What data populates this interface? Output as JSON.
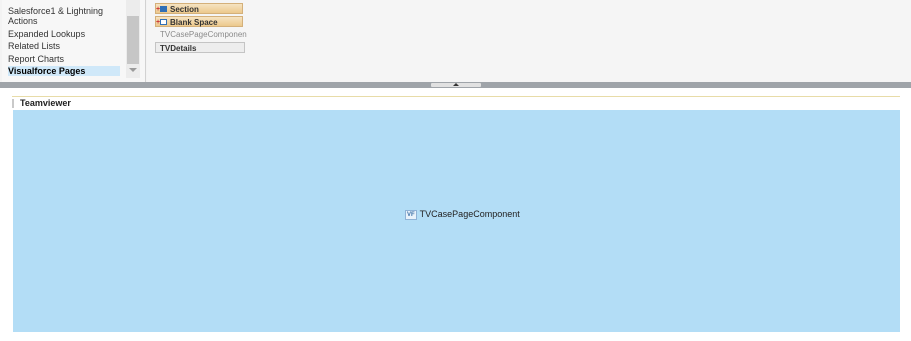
{
  "palette": {
    "categories": [
      "Salesforce1 & Lightning",
      "Actions",
      "Expanded Lookups",
      "Related Lists",
      "Report Charts",
      "Visualforce Pages"
    ],
    "selected_category": "Visualforce Pages",
    "items": [
      {
        "label": "Section",
        "icon": "add-section-icon"
      },
      {
        "label": "Blank Space",
        "icon": "add-blank-space-icon"
      },
      {
        "label": "TVCasePageComponen",
        "icon": ""
      },
      {
        "label": "TVDetails",
        "icon": ""
      }
    ]
  },
  "section": {
    "title": "Teamviewer",
    "component": {
      "badge": "VF",
      "label": "TVCasePageComponent"
    }
  },
  "colors": {
    "accent": "#b3ddf6",
    "selected": "#cfe8f9",
    "palette_button": "#ecc88c"
  }
}
